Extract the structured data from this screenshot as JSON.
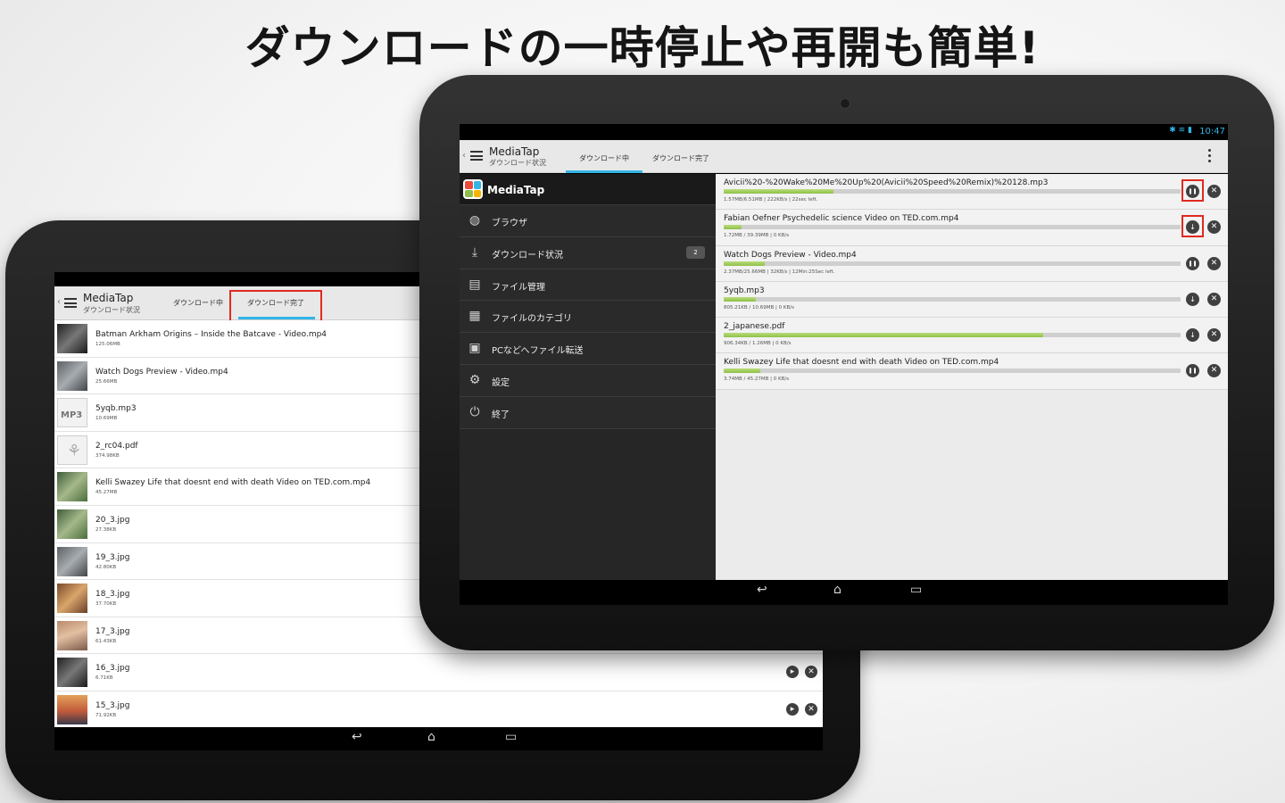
{
  "headline": "ダウンロードの一時停止や再開も簡単!",
  "back_tablet": {
    "app_title": "MediaTap",
    "app_subtitle": "ダウンロード状況",
    "tabs": [
      "ダウンロード中",
      "ダウンロード完了"
    ],
    "active_tab_index": 1,
    "files": [
      {
        "name": "Batman Arkham Origins – Inside the Batcave - Video.mp4",
        "size": "125.06MB",
        "thumb": "photo-dark"
      },
      {
        "name": "Watch Dogs Preview - Video.mp4",
        "size": "25.66MB",
        "thumb": "photo-grey"
      },
      {
        "name": "5yqb.mp3",
        "size": "10.69MB",
        "thumb": "mp3-icon"
      },
      {
        "name": "2_rc04.pdf",
        "size": "374.98KB",
        "thumb": "pdf-icon"
      },
      {
        "name": "Kelli Swazey Life that doesnt end with death  Video on TED.com.mp4",
        "size": "45.27MB",
        "thumb": "photo-green"
      },
      {
        "name": "20_3.jpg",
        "size": "27.38KB",
        "thumb": "photo-green"
      },
      {
        "name": "19_3.jpg",
        "size": "42.80KB",
        "thumb": "photo-grey"
      },
      {
        "name": "18_3.jpg",
        "size": "37.70KB",
        "thumb": "photo-sky"
      },
      {
        "name": "17_3.jpg",
        "size": "61.43KB",
        "thumb": "photo-orange"
      },
      {
        "name": "16_3.jpg",
        "size": "6.71KB",
        "thumb": "photo-dark"
      },
      {
        "name": "15_3.jpg",
        "size": "71.92KB",
        "thumb": "photo-sunset"
      }
    ],
    "row_actions": [
      "play-icon",
      "close-icon"
    ]
  },
  "front_tablet": {
    "status_time": "10:47",
    "app_title": "MediaTap",
    "app_subtitle": "ダウンロード状況",
    "tabs": [
      "ダウンロード中",
      "ダウンロード完了"
    ],
    "active_tab_index": 0,
    "drawer": {
      "app_name": "MediaTap",
      "items": [
        {
          "label": "ブラウザ",
          "icon": "globe-icon"
        },
        {
          "label": "ダウンロード状況",
          "icon": "download-tray-icon",
          "badge": "2"
        },
        {
          "label": "ファイル管理",
          "icon": "folder-icon"
        },
        {
          "label": "ファイルのカテゴリ",
          "icon": "folder-category-icon"
        },
        {
          "label": "PCなどへファイル転送",
          "icon": "pc-transfer-icon"
        },
        {
          "label": "設定",
          "icon": "gear-icon"
        },
        {
          "label": "終了",
          "icon": "power-icon"
        }
      ]
    },
    "downloads": [
      {
        "name": "Avicii%20-%20Wake%20Me%20Up%20(Avicii%20Speed%20Remix)%20128.mp3",
        "info": "1.57MB/6.51MB | 222KB/s | 22sec left.",
        "progress": 0.24,
        "control": "pause",
        "highlighted": true
      },
      {
        "name": "Fabian Oefner Psychedelic science  Video on TED.com.mp4",
        "info": "1.72MB / 39.39MB | 0 KB/s",
        "progress": 0.04,
        "control": "download",
        "highlighted": true
      },
      {
        "name": "Watch Dogs Preview - Video.mp4",
        "info": "2.37MB/25.66MB | 32KB/s | 12Min:25Sec left.",
        "progress": 0.09,
        "control": "pause",
        "highlighted": false
      },
      {
        "name": "5yqb.mp3",
        "info": "805.21KB / 10.69MB | 0 KB/s",
        "progress": 0.07,
        "control": "download",
        "highlighted": false
      },
      {
        "name": "2_japanese.pdf",
        "info": "906.34KB / 1.26MB | 0 KB/s",
        "progress": 0.7,
        "control": "download",
        "highlighted": false
      },
      {
        "name": "Kelli Swazey Life that doesnt end with death  Video on TED.com.mp4",
        "info": "3.74MB / 45.27MB | 0 KB/s",
        "progress": 0.08,
        "control": "pause",
        "highlighted": false
      }
    ]
  },
  "colors": {
    "accent_blue": "#33b5e5",
    "highlight_red": "#e02a20",
    "progress_green": "#8fbf4a"
  }
}
